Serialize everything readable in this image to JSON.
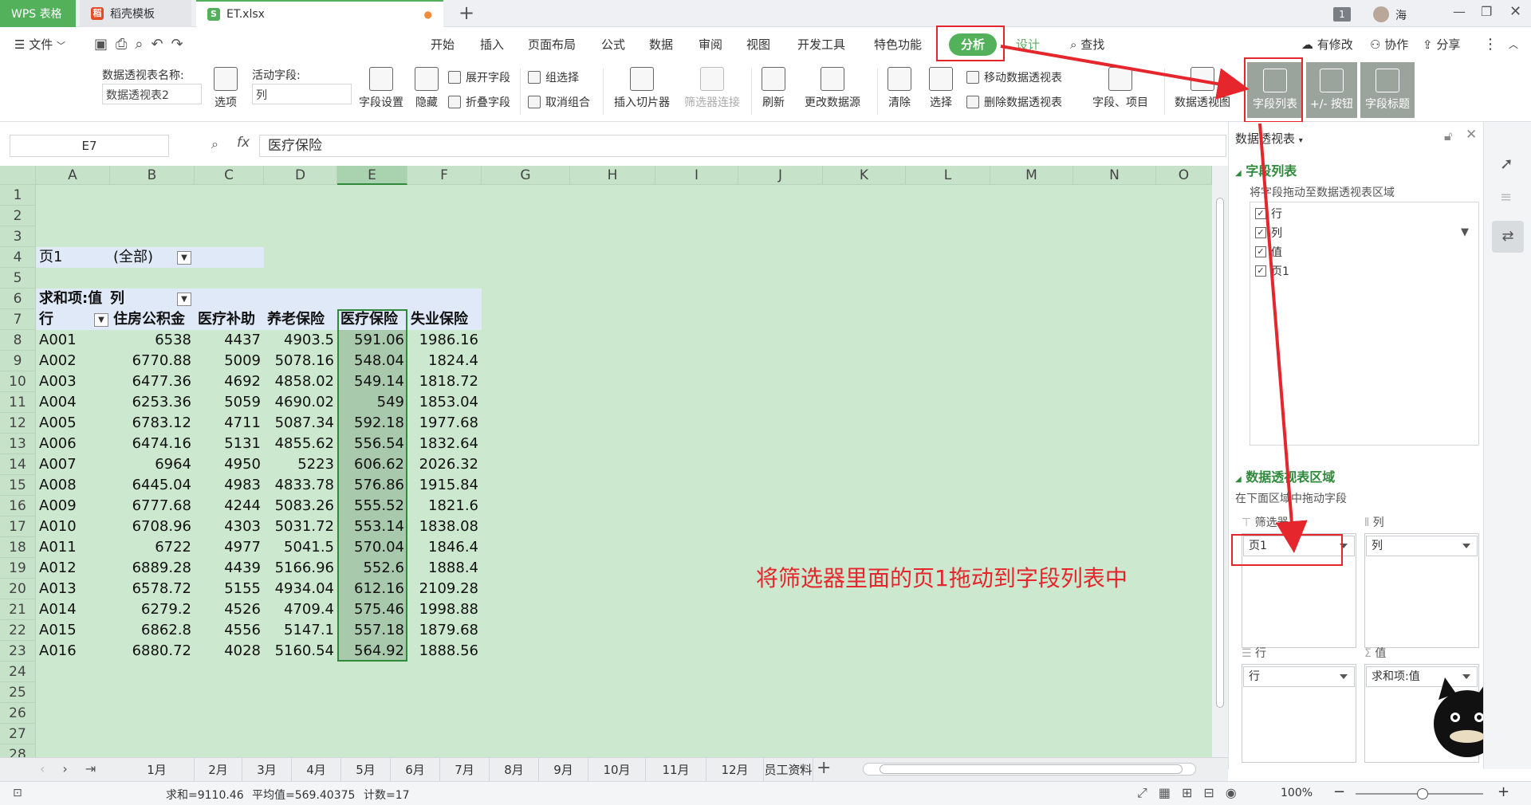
{
  "tabs": {
    "app": "WPS 表格",
    "template": "稻壳模板",
    "file": "ET.xlsx",
    "add": "+"
  },
  "window": {
    "badge": "1",
    "user": "海"
  },
  "menu": {
    "file": "文件",
    "items": [
      "开始",
      "插入",
      "页面布局",
      "公式",
      "数据",
      "审阅",
      "视图",
      "开发工具",
      "特色功能",
      "分析",
      "设计"
    ],
    "search": "查找",
    "right": [
      "有修改",
      "协作",
      "分享"
    ]
  },
  "ribbon": {
    "pivot_name_label": "数据透视表名称:",
    "pivot_name_value": "数据透视表2",
    "options": "选项",
    "active_field_label": "活动字段:",
    "active_field_value": "列",
    "field_settings": "字段设置",
    "hide": "隐藏",
    "expand_field": "展开字段",
    "collapse_field": "折叠字段",
    "group_selection": "组选择",
    "ungroup": "取消组合",
    "insert_slicer": "插入切片器",
    "filter_connections": "筛选器连接",
    "refresh": "刷新",
    "change_source": "更改数据源",
    "clear": "清除",
    "select": "选择",
    "move_pivot": "移动数据透视表",
    "delete_pivot": "删除数据透视表",
    "fields_items": "字段、项目",
    "pivot_chart": "数据透视图",
    "field_list": "字段列表",
    "plus_minus": "+/- 按钮",
    "field_headers": "字段标题"
  },
  "formula_bar": {
    "cell_ref": "E7",
    "fx": "fx",
    "content": "医疗保险"
  },
  "grid": {
    "columns": [
      "A",
      "B",
      "C",
      "D",
      "E",
      "F",
      "G",
      "H",
      "I",
      "J",
      "K",
      "L",
      "M",
      "N",
      "O"
    ],
    "rows": [
      "1",
      "2",
      "3",
      "4",
      "5",
      "6",
      "7",
      "8",
      "9",
      "10",
      "11",
      "12",
      "13",
      "14",
      "15",
      "16",
      "17",
      "18",
      "19",
      "20",
      "21",
      "22",
      "23",
      "24",
      "25",
      "26",
      "27",
      "28"
    ],
    "page_label": "页1",
    "page_value": "(全部)",
    "sum_label": "求和项:值",
    "col_label": "列",
    "row_label": "行",
    "headers": [
      "住房公积金",
      "医疗补助",
      "养老保险",
      "医疗保险",
      "失业保险"
    ],
    "data": [
      [
        "A001",
        "6538",
        "4437",
        "4903.5",
        "591.06",
        "1986.16"
      ],
      [
        "A002",
        "6770.88",
        "5009",
        "5078.16",
        "548.04",
        "1824.4"
      ],
      [
        "A003",
        "6477.36",
        "4692",
        "4858.02",
        "549.14",
        "1818.72"
      ],
      [
        "A004",
        "6253.36",
        "5059",
        "4690.02",
        "549",
        "1853.04"
      ],
      [
        "A005",
        "6783.12",
        "4711",
        "5087.34",
        "592.18",
        "1977.68"
      ],
      [
        "A006",
        "6474.16",
        "5131",
        "4855.62",
        "556.54",
        "1832.64"
      ],
      [
        "A007",
        "6964",
        "4950",
        "5223",
        "606.62",
        "2026.32"
      ],
      [
        "A008",
        "6445.04",
        "4983",
        "4833.78",
        "576.86",
        "1915.84"
      ],
      [
        "A009",
        "6777.68",
        "4244",
        "5083.26",
        "555.52",
        "1821.6"
      ],
      [
        "A010",
        "6708.96",
        "4303",
        "5031.72",
        "553.14",
        "1838.08"
      ],
      [
        "A011",
        "6722",
        "4977",
        "5041.5",
        "570.04",
        "1846.4"
      ],
      [
        "A012",
        "6889.28",
        "4439",
        "5166.96",
        "552.6",
        "1888.4"
      ],
      [
        "A013",
        "6578.72",
        "5155",
        "4934.04",
        "612.16",
        "2109.28"
      ],
      [
        "A014",
        "6279.2",
        "4526",
        "4709.4",
        "575.46",
        "1998.88"
      ],
      [
        "A015",
        "6862.8",
        "4556",
        "5147.1",
        "557.18",
        "1879.68"
      ],
      [
        "A016",
        "6880.72",
        "4028",
        "5160.54",
        "564.92",
        "1888.56"
      ]
    ]
  },
  "annotation": "将筛选器里面的页1拖动到字段列表中",
  "pane": {
    "title": "数据透视表",
    "field_list_heading": "字段列表",
    "field_list_hint": "将字段拖动至数据透视表区域",
    "fields": [
      "行",
      "列",
      "值",
      "页1"
    ],
    "areas_heading": "数据透视表区域",
    "areas_hint": "在下面区域中拖动字段",
    "filter_label": "筛选器",
    "filter_value": "页1",
    "columns_label": "列",
    "columns_value": "列",
    "rows_label": "行",
    "rows_value": "行",
    "values_label": "值",
    "values_value": "求和项:值"
  },
  "sheets": [
    "1月",
    "2月",
    "3月",
    "4月",
    "5月",
    "6月",
    "7月",
    "8月",
    "9月",
    "10月",
    "11月",
    "12月",
    "员工资料"
  ],
  "sheet_more": "···",
  "status": {
    "sum": "求和=9110.46",
    "avg": "平均值=569.40375",
    "count": "计数=17",
    "zoom": "100%"
  },
  "colors": {
    "accent": "#53b05b",
    "annotation": "#e5262c",
    "grid_bg": "#cce8cf"
  }
}
